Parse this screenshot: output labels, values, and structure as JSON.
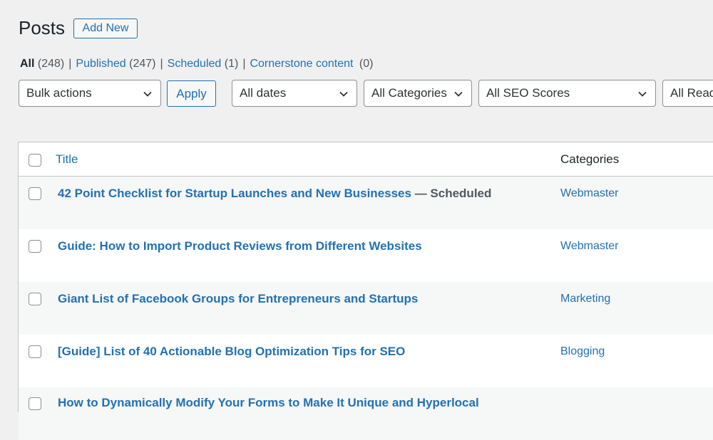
{
  "header": {
    "title": "Posts",
    "add_new_label": "Add New"
  },
  "views": [
    {
      "label": "All",
      "count": "(248)"
    },
    {
      "label": "Published",
      "count": "(247)"
    },
    {
      "label": "Scheduled",
      "count": "(1)"
    },
    {
      "label": "Cornerstone content",
      "count": "(0)"
    }
  ],
  "filters": {
    "bulk_actions": "Bulk actions",
    "apply_label": "Apply",
    "dates": "All dates",
    "categories": "All Categories",
    "seo_scores": "All SEO Scores",
    "readability": "All Readability Scores"
  },
  "table": {
    "headers": {
      "title": "Title",
      "categories": "Categories"
    },
    "rows": [
      {
        "title": "42 Point Checklist for Startup Launches and New Businesses",
        "state": " — Scheduled",
        "category": "Webmaster"
      },
      {
        "title": "Guide: How to Import Product Reviews from Different Websites",
        "state": "",
        "category": "Webmaster"
      },
      {
        "title": "Giant List of Facebook Groups for Entrepreneurs and Startups",
        "state": "",
        "category": "Marketing"
      },
      {
        "title": "[Guide] List of 40 Actionable Blog Optimization Tips for SEO",
        "state": "",
        "category": "Blogging"
      },
      {
        "title": "How to Dynamically Modify Your Forms to Make It Unique and Hyperlocal",
        "state": "",
        "category": ""
      }
    ]
  },
  "colors": {
    "link": "#2271b1",
    "text": "#1d2327",
    "background": "#f0f0f1",
    "border": "#c3c4c7"
  }
}
